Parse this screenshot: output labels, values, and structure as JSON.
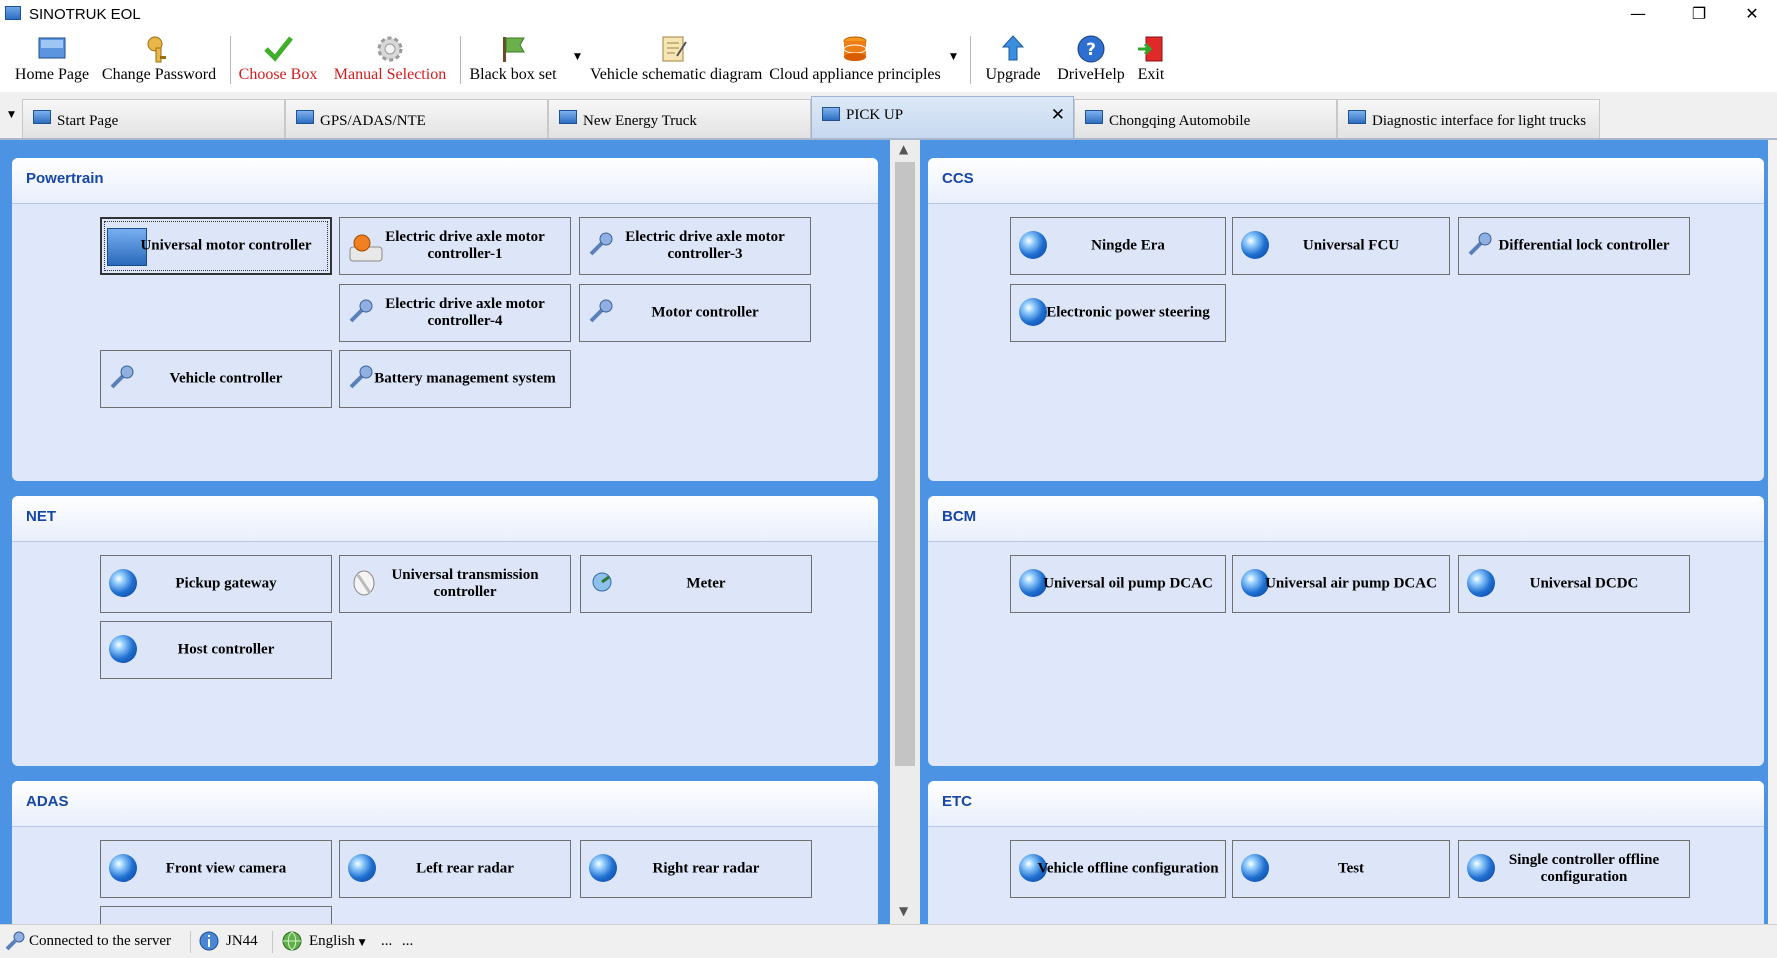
{
  "window": {
    "title": "SINOTRUK EOL",
    "minimize": "—",
    "restore": "❐",
    "close": "✕"
  },
  "toolbar": {
    "home_page": "Home Page",
    "change_password": "Change Password",
    "choose_box": "Choose Box",
    "manual_selection": "Manual Selection",
    "black_box_set": "Black box set",
    "vehicle_schematic_diagram": "Vehicle schematic diagram",
    "cloud_appliance_principles": "Cloud appliance principles",
    "upgrade": "Upgrade",
    "drivehelp": "DriveHelp",
    "exit": "Exit"
  },
  "tabs": {
    "start_page": "Start Page",
    "gps_adas_nte": "GPS/ADAS/NTE",
    "new_energy_truck": "New Energy Truck",
    "pick_up": "PICK UP",
    "chongqing_automobile": "Chongqing Automobile",
    "diagnostic_light_trucks": "Diagnostic interface for light trucks",
    "active": "PICK UP"
  },
  "groups": {
    "powertrain": {
      "title": "Powertrain",
      "buttons": [
        "Universal motor controller",
        "Electric drive axle motor controller-1",
        "Electric drive axle motor controller-3",
        "Electric drive axle motor controller-4",
        "Motor controller",
        "Vehicle controller",
        "Battery management system"
      ]
    },
    "ccs": {
      "title": "CCS",
      "buttons": [
        "Ningde Era",
        "Universal FCU",
        "Differential lock controller",
        "Electronic power steering"
      ]
    },
    "net": {
      "title": "NET",
      "buttons": [
        "Pickup gateway",
        "Universal transmission controller",
        "Meter",
        "Host controller"
      ]
    },
    "bcm": {
      "title": "BCM",
      "buttons": [
        "Universal oil pump DCAC",
        "Universal air pump DCAC",
        "Universal DCDC"
      ]
    },
    "adas": {
      "title": "ADAS",
      "buttons": [
        "Front view camera",
        "Left rear radar",
        "Right rear radar"
      ]
    },
    "etc": {
      "title": "ETC",
      "buttons": [
        "Vehicle offline configuration",
        "Test",
        "Single controller offline configuration"
      ]
    }
  },
  "statusbar": {
    "connection": "Connected to the server",
    "version": "JN44",
    "language": "English",
    "extra1": "...",
    "extra2": "..."
  },
  "colors": {
    "accent_blue": "#4d93e3",
    "group_background": "#dfe8fb",
    "group_title": "#1747a6",
    "red_label": "#d41c1c"
  }
}
